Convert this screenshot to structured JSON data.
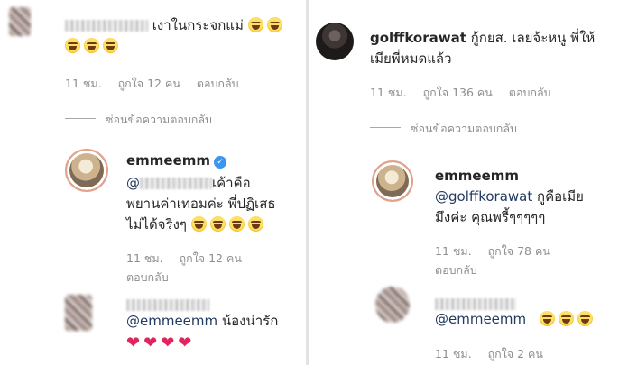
{
  "left": {
    "c1": {
      "text": "เงาในกระจกแม่",
      "time": "11 ชม.",
      "likes": "ถูกใจ 12 คน",
      "reply": "ตอบกลับ"
    },
    "hide_replies": "ซ่อนข้อความตอบกลับ",
    "r1": {
      "username": "emmeemm",
      "mention": "@",
      "line1": "เค้าคือ",
      "line2": "พยานค่าเทอมค่ะ พี่ปฏิเสธ",
      "line3": "ไม่ได้จริงๆ",
      "time": "11 ชม.",
      "likes": "ถูกใจ 12 คน",
      "reply": "ตอบกลับ"
    },
    "r2": {
      "mention": "@emmeemm",
      "text": "น้องน่ารัก",
      "hearts": [
        "❤",
        "❤",
        "❤",
        "❤"
      ]
    }
  },
  "right": {
    "c1": {
      "username": "golffkorawat",
      "line1": "กู้กยส. เลยจ้ะหนู พี่ให้",
      "line2": "เมียพี่หมดแล้ว",
      "time": "11 ชม.",
      "likes": "ถูกใจ 136 คน",
      "reply": "ตอบกลับ"
    },
    "hide_replies": "ซ่อนข้อความตอบกลับ",
    "r1": {
      "username": "emmeemm",
      "mention": "@golffkorawat",
      "line1": "กูคือเมีย",
      "line2": "มึงค่ะ คุณพรี้ๆๆๆๆๆ",
      "time": "11 ชม.",
      "likes": "ถูกใจ 78 คน",
      "reply": "ตอบกลับ"
    },
    "r2": {
      "mention": "@emmeemm",
      "time": "11 ชม.",
      "likes": "ถูกใจ 2 คน"
    }
  },
  "colors": {
    "mention": "#233a60",
    "meta": "#8e8e8e",
    "verified": "#3897f0",
    "heart": "#e0245e"
  }
}
